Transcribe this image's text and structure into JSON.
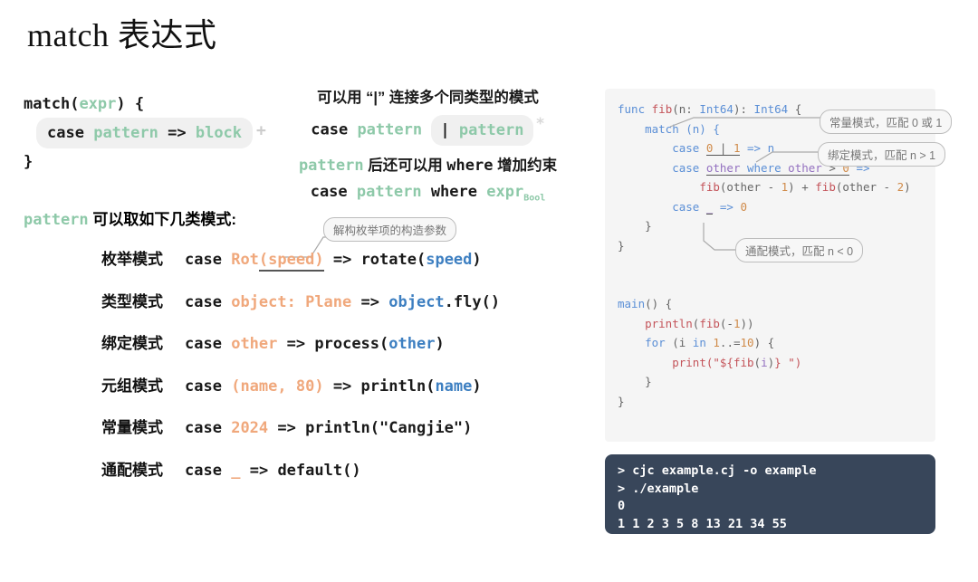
{
  "title": "match 表达式",
  "schema": {
    "line1_kw": "match",
    "line1_paren_open": "(",
    "line1_expr": "expr",
    "line1_paren_close": ") {",
    "case_kw": "case",
    "case_pattern": "pattern",
    "case_arrow": "=>",
    "case_block": "block",
    "plus_marker": "+",
    "line3": "}"
  },
  "notes": {
    "note1_cn": "可以用 “|” 连接多个同类型的模式",
    "note1_case": "case",
    "note1_pattern_a": "pattern",
    "note1_sep": "|",
    "note1_pattern_b": "pattern",
    "star_marker": "*",
    "note2_pattern": "pattern",
    "note2_cn_a": "后还可以用",
    "note2_where": "where",
    "note2_cn_b": "增加约束",
    "note2_case": "case",
    "note2_pattern_b": "pattern",
    "note2_where_b": "where",
    "note2_expr": "expr",
    "note2_expr_sub": "Bool"
  },
  "pattern_section": {
    "intro_code": "pattern",
    "intro_cn": "可以取如下几类模式:",
    "callout_enum": "解构枚举项的构造参数",
    "rows": [
      {
        "label": "枚举模式",
        "kw": "case",
        "pat_head": "Rot",
        "pat_args": "(speed)",
        "arrow": "=>",
        "body_fn": "rotate(",
        "body_var": "speed",
        "body_tail": ")"
      },
      {
        "label": "类型模式",
        "kw": "case",
        "pat_head": "object: Plane",
        "pat_args": "",
        "arrow": "=>",
        "body_fn": "",
        "body_var": "object",
        "body_tail": ".fly()"
      },
      {
        "label": "绑定模式",
        "kw": "case",
        "pat_head": "other",
        "pat_args": "",
        "arrow": "=>",
        "body_fn": "process(",
        "body_var": "other",
        "body_tail": ")"
      },
      {
        "label": "元组模式",
        "kw": "case",
        "pat_head": "(name, 80)",
        "pat_args": "",
        "arrow": "=>",
        "body_fn": "println(",
        "body_var": "name",
        "body_tail": ")"
      },
      {
        "label": "常量模式",
        "kw": "case",
        "pat_head": "2024",
        "pat_args": "",
        "arrow": "=>",
        "body_fn": "println(\"Cangjie\")",
        "body_var": "",
        "body_tail": ""
      },
      {
        "label": "通配模式",
        "kw": "case",
        "pat_head": "_",
        "pat_args": "",
        "arrow": "=>",
        "body_fn": "default()",
        "body_var": "",
        "body_tail": ""
      }
    ]
  },
  "code_panel": {
    "l1_kw": "func ",
    "l1_fn": "fib",
    "l1_mid": "(n: ",
    "l1_t1": "Int64",
    "l1_mid2": "): ",
    "l1_t2": "Int64",
    "l1_tail": " {",
    "l2": "    match (n) {",
    "l3_a": "        case ",
    "l3_n0": "0",
    "l3_bar": " | ",
    "l3_n1": "1",
    "l3_tail": " => n",
    "l4_a": "        case ",
    "l4_v1": "other",
    "l4_kw": " where ",
    "l4_v2": "other",
    "l4_op": " > ",
    "l4_n": "0",
    "l4_tail": " =>",
    "l5_a": "            ",
    "l5_f1": "fib",
    "l5_m1": "(other - ",
    "l5_n1": "1",
    "l5_m2": ") + ",
    "l5_f2": "fib",
    "l5_m3": "(other - ",
    "l5_n2": "2",
    "l5_tail": ")",
    "l6_a": "        case ",
    "l6_us": "_",
    "l6_m": " => ",
    "l6_n": "0",
    "l7": "    }",
    "l8": "}",
    "l10_m": "main",
    "l10_tail": "() {",
    "l11_a": "    ",
    "l11_f": "println",
    "l11_m": "(",
    "l11_f2": "fib",
    "l11_m2": "(-",
    "l11_n": "1",
    "l11_tail": "))",
    "l12_a": "    ",
    "l12_kw": "for",
    "l12_m": " (i ",
    "l12_in": "in",
    "l12_m2": " ",
    "l12_n1": "1",
    "l12_dots": "..=",
    "l12_n2": "10",
    "l12_tail": ") {",
    "l13_a": "        ",
    "l13_f": "print",
    "l13_m": "(\"${",
    "l13_f2": "fib",
    "l13_m2": "(",
    "l13_v": "i",
    "l13_m3": ")",
    "l13_m4": "} \")",
    "l14": "    }",
    "l15": "}",
    "callout_a": "常量模式，匹配 0 或 1",
    "callout_b": "绑定模式，匹配 n > 1",
    "callout_c": "通配模式，匹配 n < 0"
  },
  "terminal": {
    "lines": [
      "> cjc example.cj -o example",
      "> ./example",
      "0",
      "1 1 2 3 5 8 13 21 34 55"
    ]
  },
  "colors": {
    "green": "#8ec9a9",
    "orange": "#f0a87c",
    "blue": "#3d7fc1",
    "code_blue": "#5b8fd6",
    "code_red": "#c4545a",
    "code_purple": "#9370c0",
    "code_orange": "#d08b4a",
    "panel_bg": "#f5f5f5",
    "terminal_bg": "#38465a",
    "pill_bg": "#f0f0f0"
  }
}
